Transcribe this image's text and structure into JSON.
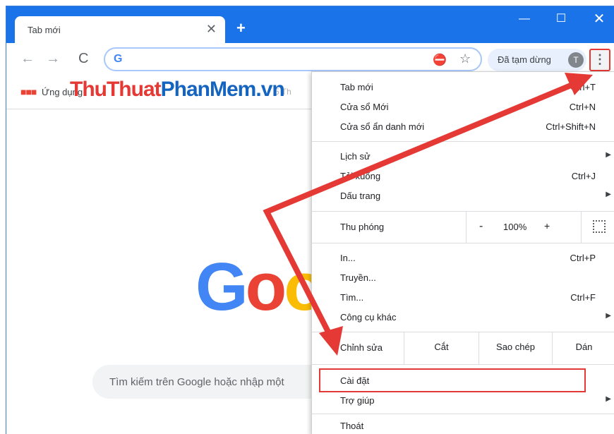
{
  "tab": {
    "title": "Tab mới",
    "close_glyph": "✕",
    "new_tab_glyph": "+"
  },
  "window_controls": {
    "minimize": "—",
    "maximize": "☐",
    "close": "✕"
  },
  "toolbar": {
    "back_glyph": "←",
    "forward_glyph": "→",
    "reload_glyph": "C",
    "omnibox_logo": "G",
    "omnibox_value": "",
    "extension_glyph": "⛔",
    "star_glyph": "☆",
    "paused_label": "Đã tạm dừng",
    "avatar_letter": "T",
    "menu_glyph": "⋮"
  },
  "bookmarks": {
    "apps_glyph": "■■■",
    "apps_label": "Ứng dụng",
    "faint_item": "5 Th"
  },
  "watermark": {
    "part1": "Thu",
    "part2": "Thuat",
    "part3": "Phan",
    "part4": "Mem",
    "part5": ".vn"
  },
  "page": {
    "logo_letters": [
      "G",
      "o",
      "o"
    ],
    "search_placeholder": "Tìm kiếm trên Google hoặc nhập một"
  },
  "menu": {
    "new_tab": {
      "label": "Tab mới",
      "shortcut": "Ctrl+T"
    },
    "new_window": {
      "label": "Cửa sổ Mới",
      "shortcut": "Ctrl+N"
    },
    "incognito": {
      "label": "Cửa sổ ẩn danh mới",
      "shortcut": "Ctrl+Shift+N"
    },
    "history": {
      "label": "Lịch sử"
    },
    "downloads": {
      "label": "Tải xuống",
      "shortcut": "Ctrl+J"
    },
    "bookmarks": {
      "label": "Dấu trang"
    },
    "zoom": {
      "label": "Thu phóng",
      "minus": "-",
      "value": "100%",
      "plus": "+"
    },
    "print": {
      "label": "In...",
      "shortcut": "Ctrl+P"
    },
    "cast": {
      "label": "Truyền..."
    },
    "find": {
      "label": "Tìm...",
      "shortcut": "Ctrl+F"
    },
    "more_tools": {
      "label": "Công cụ khác"
    },
    "edit": {
      "label": "Chỉnh sửa",
      "cut": "Cắt",
      "copy": "Sao chép",
      "paste": "Dán"
    },
    "settings": {
      "label": "Cài đặt"
    },
    "help": {
      "label": "Trợ giúp"
    },
    "exit": {
      "label": "Thoát"
    },
    "submenu_arrow": "▶"
  },
  "colors": {
    "accent": "#1a73e8",
    "annotation": "#e53935"
  }
}
